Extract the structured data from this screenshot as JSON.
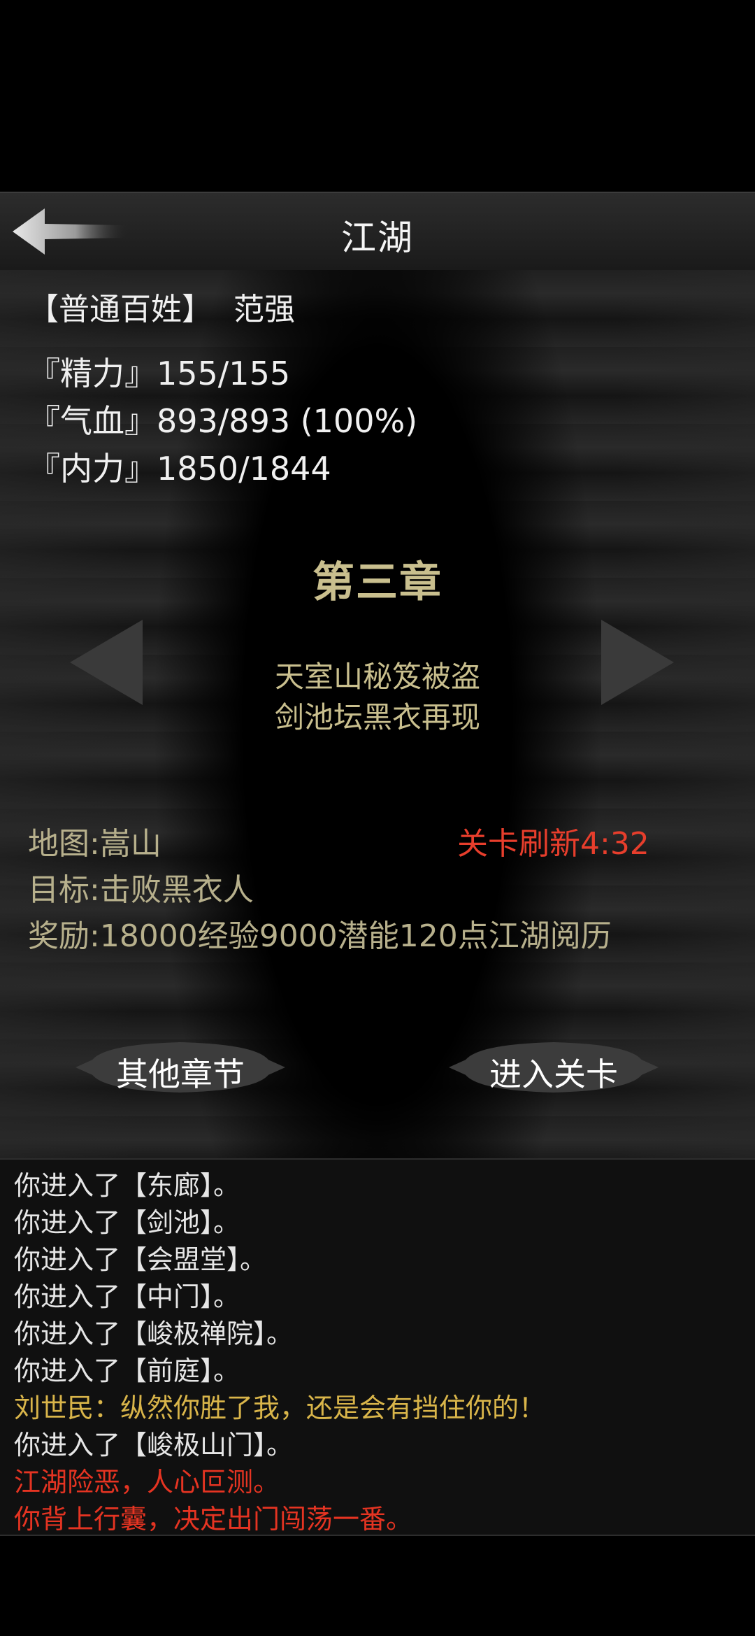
{
  "header": {
    "title": "江湖"
  },
  "player": {
    "rank": "【普通百姓】",
    "name": "范强"
  },
  "stats": [
    "『精力』155/155",
    "『气血』893/893 (100%)",
    "『内力』1850/1844"
  ],
  "chapter": {
    "title": "第三章",
    "line1": "天室山秘笈被盗",
    "line2": "剑池坛黑衣再现"
  },
  "info": {
    "map": "地图:嵩山",
    "target": "目标:击败黑衣人",
    "reward": "奖励:18000经验9000潜能120点江湖阅历",
    "refresh": "关卡刷新4:32"
  },
  "buttons": {
    "other": "其他章节",
    "enter": "进入关卡"
  },
  "log": [
    {
      "text": "你进入了【东廊】。",
      "color": "#e6e6e6"
    },
    {
      "text": "你进入了【剑池】。",
      "color": "#e6e6e6"
    },
    {
      "text": "你进入了【会盟堂】。",
      "color": "#e6e6e6"
    },
    {
      "text": "你进入了【中门】。",
      "color": "#e6e6e6"
    },
    {
      "text": "你进入了【峻极禅院】。",
      "color": "#e6e6e6"
    },
    {
      "text": "你进入了【前庭】。",
      "color": "#e6e6e6"
    },
    {
      "text": "刘世民：纵然你胜了我，还是会有挡住你的！",
      "color": "#d9b54a"
    },
    {
      "text": "你进入了【峻极山门】。",
      "color": "#e6e6e6"
    },
    {
      "text": "江湖险恶，人心叵测。",
      "color": "#e53422"
    },
    {
      "text": "你背上行囊，决定出门闯荡一番。",
      "color": "#e53422"
    }
  ],
  "colors": {
    "chapter_gold": "#c9bf8e",
    "info_text": "#b7b08c",
    "refresh_red": "#e73e2c",
    "dialog_yellow": "#d9b54a",
    "warning_red": "#e53422"
  },
  "icons": [
    "back-arrow-icon",
    "left-arrow-icon",
    "right-arrow-icon"
  ]
}
